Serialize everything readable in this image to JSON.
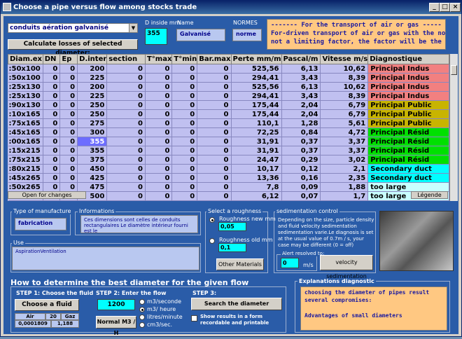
{
  "window": {
    "title": "Choose a pipe versus flow among stocks trade",
    "minimize": "_",
    "maximize": "□",
    "close": "×"
  },
  "material_select": {
    "value": "conduits aération galvanisé"
  },
  "calc_button": "Calculate losses of selected diameter:",
  "d_inside": {
    "label": "D inside mm",
    "value": "355"
  },
  "name": {
    "label": "Name",
    "value": "Galvanisé"
  },
  "normes": {
    "label": "NORMES",
    "value": "norme"
  },
  "info_text": "------- For the transport of air or gas -----\nFor-driven transport of air or gas with the noise\nnot a limiting factor, the factor will be the",
  "table": {
    "headers": [
      "Diam.ex",
      "DN",
      "Ep",
      "D.inter",
      "section",
      "T°max",
      "T°min",
      "Bar.max",
      "Perte mm/m",
      "Pascal/m",
      "Vitesse m/s",
      "Diagnostique"
    ],
    "rows": [
      {
        "diam": ":50x100",
        "dn": "0",
        "ep": "0",
        "dint": "200",
        "sec": "0",
        "tmax": "0",
        "tmin": "0",
        "bar": "0",
        "perte": "525,56",
        "pascal": "6,13",
        "vit": "10,62",
        "diag": "Principal Indus",
        "color": "#f28080"
      },
      {
        "diam": ":50x100",
        "dn": "0",
        "ep": "0",
        "dint": "225",
        "sec": "0",
        "tmax": "0",
        "tmin": "0",
        "bar": "0",
        "perte": "294,41",
        "pascal": "3,43",
        "vit": "8,39",
        "diag": "Principal Indus",
        "color": "#f28080"
      },
      {
        "diam": ":25x130",
        "dn": "0",
        "ep": "0",
        "dint": "200",
        "sec": "0",
        "tmax": "0",
        "tmin": "0",
        "bar": "0",
        "perte": "525,56",
        "pascal": "6,13",
        "vit": "10,62",
        "diag": "Principal Indus",
        "color": "#f28080"
      },
      {
        "diam": ":25x130",
        "dn": "0",
        "ep": "0",
        "dint": "225",
        "sec": "0",
        "tmax": "0",
        "tmin": "0",
        "bar": "0",
        "perte": "294,41",
        "pascal": "3,43",
        "vit": "8,39",
        "diag": "Principal Indus",
        "color": "#f28080"
      },
      {
        "diam": ":90x130",
        "dn": "0",
        "ep": "0",
        "dint": "250",
        "sec": "0",
        "tmax": "0",
        "tmin": "0",
        "bar": "0",
        "perte": "175,44",
        "pascal": "2,04",
        "vit": "6,79",
        "diag": "Principal Public",
        "color": "#c8b400"
      },
      {
        "diam": ":10x165",
        "dn": "0",
        "ep": "0",
        "dint": "250",
        "sec": "0",
        "tmax": "0",
        "tmin": "0",
        "bar": "0",
        "perte": "175,44",
        "pascal": "2,04",
        "vit": "6,79",
        "diag": "Principal Public",
        "color": "#c8b400"
      },
      {
        "diam": ":75x165",
        "dn": "0",
        "ep": "0",
        "dint": "275",
        "sec": "0",
        "tmax": "0",
        "tmin": "0",
        "bar": "0",
        "perte": "110,1",
        "pascal": "1,28",
        "vit": "5,61",
        "diag": "Principal Public",
        "color": "#c8b400"
      },
      {
        "diam": ":45x165",
        "dn": "0",
        "ep": "0",
        "dint": "300",
        "sec": "0",
        "tmax": "0",
        "tmin": "0",
        "bar": "0",
        "perte": "72,25",
        "pascal": "0,84",
        "vit": "4,72",
        "diag": "Principal Résid",
        "color": "#00e000"
      },
      {
        "diam": ":00x165",
        "dn": "0",
        "ep": "0",
        "dint": "355",
        "sec": "0",
        "tmax": "0",
        "tmin": "0",
        "bar": "0",
        "perte": "31,91",
        "pascal": "0,37",
        "vit": "3,37",
        "diag": "Principal Résid",
        "color": "#00e000",
        "selected": true
      },
      {
        "diam": ":15x215",
        "dn": "0",
        "ep": "0",
        "dint": "355",
        "sec": "0",
        "tmax": "0",
        "tmin": "0",
        "bar": "0",
        "perte": "31,91",
        "pascal": "0,37",
        "vit": "3,37",
        "diag": "Principal Résid",
        "color": "#00e000"
      },
      {
        "diam": ":75x215",
        "dn": "0",
        "ep": "0",
        "dint": "375",
        "sec": "0",
        "tmax": "0",
        "tmin": "0",
        "bar": "0",
        "perte": "24,47",
        "pascal": "0,29",
        "vit": "3,02",
        "diag": "Principal Résid",
        "color": "#00e000"
      },
      {
        "diam": ":80x215",
        "dn": "0",
        "ep": "0",
        "dint": "450",
        "sec": "0",
        "tmax": "0",
        "tmin": "0",
        "bar": "0",
        "perte": "10,17",
        "pascal": "0,12",
        "vit": "2,1",
        "diag": "Secondary duct",
        "color": "#00ffff"
      },
      {
        "diam": ":45x265",
        "dn": "0",
        "ep": "0",
        "dint": "425",
        "sec": "0",
        "tmax": "0",
        "tmin": "0",
        "bar": "0",
        "perte": "13,36",
        "pascal": "0,16",
        "vit": "2,35",
        "diag": "Secondary duct",
        "color": "#00ffff"
      },
      {
        "diam": ":50x265",
        "dn": "0",
        "ep": "0",
        "dint": "475",
        "sec": "0",
        "tmax": "0",
        "tmin": "0",
        "bar": "0",
        "perte": "7,8",
        "pascal": "0,09",
        "vit": "1,88",
        "diag": "too large",
        "color": "#c8ffff"
      },
      {
        "diam": "",
        "dn": "0",
        "ep": "0",
        "dint": "500",
        "sec": "0",
        "tmax": "0",
        "tmin": "0",
        "bar": "0",
        "perte": "6,12",
        "pascal": "0,07",
        "vit": "1,7",
        "diag": "too large",
        "color": "#c8ffff"
      }
    ]
  },
  "grid_tip": "Open for changes",
  "legend_button": "Légende",
  "type_manufacture": {
    "label": "Type of manufacture",
    "value": "fabrication"
  },
  "informations": {
    "label": "Informations",
    "value": "Ces dimensions sont celles de conduits rectangulaires Le diamètre intérieur fourni est le"
  },
  "use": {
    "label": "Use",
    "value": "AspirationVentilation"
  },
  "roughness": {
    "label": "Select a roughness",
    "new_label": "Roughness new mm",
    "new_value": "0,05",
    "old_label": "Roughness old mm",
    "old_value": "0,1",
    "other_button": "Other Materials"
  },
  "sedimentation": {
    "label": "sedimentation control",
    "text": "Depending on the size, particle density and fluid velocity sedimentation sedimentation varie.Le diagnosis is set at the usual value of 0.7m / s, your case may be different (0 = off)",
    "alert_label": "Alert resolved to:",
    "alert_value": "0",
    "unit": "m/s",
    "button": "velocity sedimentation"
  },
  "how_title": "How to determine the best diameter for the given flow",
  "step1": {
    "title": "STEP 1: Choose the fluid",
    "button": "Choose a fluid",
    "col1": "Air",
    "col2": "20",
    "col3": "Gaz",
    "val1": "0,0001809",
    "val2": "1,188"
  },
  "step2": {
    "title": "STEP 2: Enter the flow",
    "value": "1200",
    "button": "Normal M3 / H",
    "options": [
      "m3/seconde",
      "m3/ heure",
      "litres/minute",
      "cm3/sec."
    ],
    "selected": 1
  },
  "step3": {
    "title": "STEP 3:",
    "button": "Search the diameter",
    "checkbox_label": "Show results in a form recordable and printable"
  },
  "explanations": {
    "label": "Explanations diagnostic",
    "text": "choosing the diameter of pipes result\nseveral compromises:\n\nAdvantages of small diameters"
  }
}
